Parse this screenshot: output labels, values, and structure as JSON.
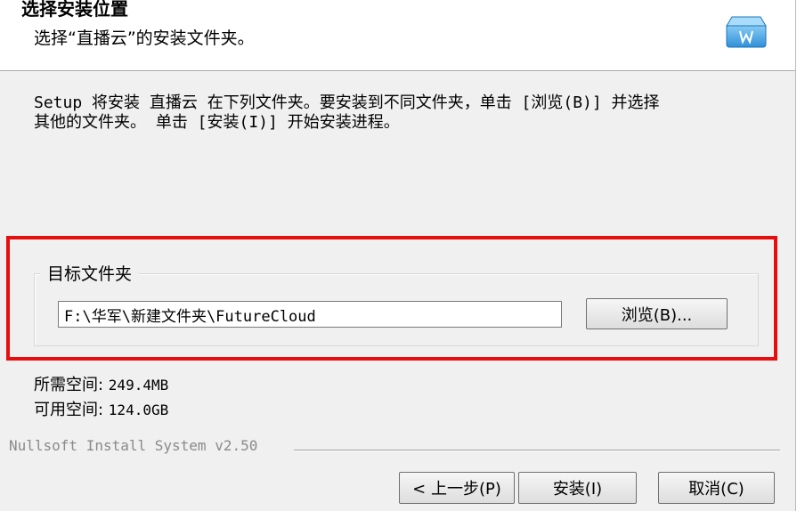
{
  "header": {
    "title": "选择安装位置",
    "subtitle": "选择“直播云”的安装文件夹。",
    "icon": "installer-box-icon"
  },
  "intro_text": "Setup 将安装 直播云 在下列文件夹。要安装到不同文件夹，单击 [浏览(B)] 并选择\n其他的文件夹。 单击 [安装(I)] 开始安装进程。",
  "destination": {
    "group_label": "目标文件夹",
    "path_value": "F:\\华军\\新建文件夹\\FutureCloud",
    "browse_label": "浏览(B)..."
  },
  "space": {
    "required_label": "所需空间: ",
    "required_value": "249.4MB",
    "available_label": "可用空间: ",
    "available_value": "124.0GB"
  },
  "footer": {
    "nsis_label": "Nullsoft Install System v2.50",
    "back_label": "< 上一步(P)",
    "install_label": "安装(I)",
    "cancel_label": "取消(C)"
  },
  "colors": {
    "highlight": "#e80e0e",
    "icon_blue": "#4ba3e3"
  }
}
